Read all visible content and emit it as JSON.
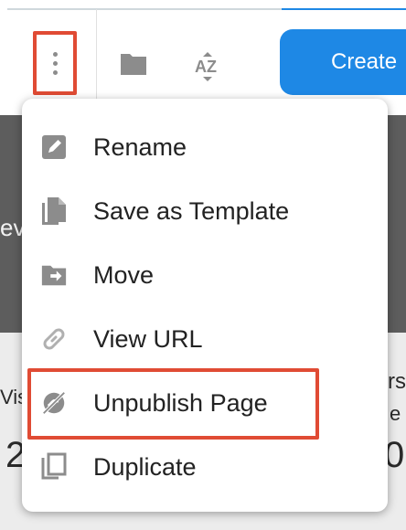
{
  "toolbar": {
    "more_button_icon": "more-vertical-icon",
    "folder_icon": "folder-icon",
    "sort_icon": "sort-az-icon",
    "sort_text": "AZ",
    "create_label": "Create"
  },
  "background": {
    "left_text_top": "ev",
    "left_text_bottom": "Vis",
    "left_digit": "2",
    "right_text_top": "rs",
    "right_text_sub": "e",
    "right_digit": "0"
  },
  "menu": {
    "items": [
      {
        "label": "Rename",
        "icon": "pencil-icon"
      },
      {
        "label": "Save as Template",
        "icon": "copy-file-icon"
      },
      {
        "label": "Move",
        "icon": "folder-move-icon"
      },
      {
        "label": "View URL",
        "icon": "link-icon"
      },
      {
        "label": "Unpublish Page",
        "icon": "unpublish-icon"
      },
      {
        "label": "Duplicate",
        "icon": "duplicate-icon"
      }
    ]
  },
  "colors": {
    "accent": "#1e88e5",
    "highlight": "#e04b34",
    "icon_gray": "#8c8c8c"
  }
}
